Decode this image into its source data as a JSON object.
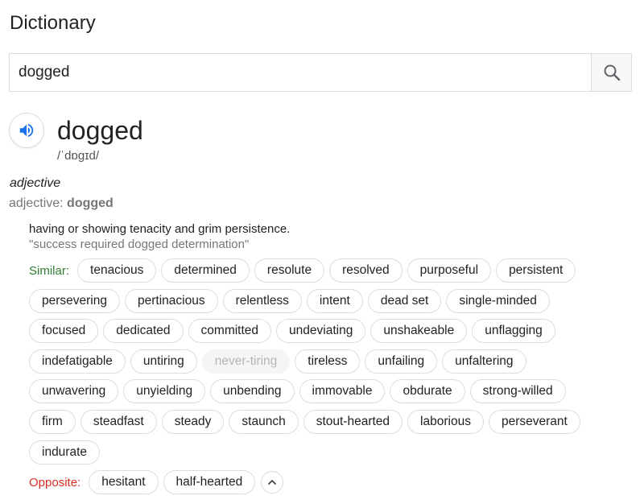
{
  "header": {
    "title": "Dictionary"
  },
  "search": {
    "value": "dogged",
    "placeholder": ""
  },
  "entry": {
    "word": "dogged",
    "phonetic": "/ˈdɒɡɪd/",
    "part_of_speech": "adjective",
    "pos_prefix": "adjective: ",
    "pos_word": "dogged",
    "definition": "having or showing tenacity and grim persistence.",
    "example": "\"success required dogged determination\""
  },
  "similar": {
    "label": "Similar:",
    "rows": [
      [
        "tenacious",
        "determined",
        "resolute",
        "resolved",
        "purposeful",
        "persistent"
      ],
      [
        "persevering",
        "pertinacious",
        "relentless",
        "intent",
        "dead set",
        "single-minded"
      ],
      [
        "focused",
        "dedicated",
        "committed",
        "undeviating",
        "unshakeable",
        "unflagging"
      ],
      [
        "indefatigable",
        "untiring",
        "never-tiring",
        "tireless",
        "unfailing",
        "unfaltering"
      ],
      [
        "unwavering",
        "unyielding",
        "unbending",
        "immovable",
        "obdurate",
        "strong-willed"
      ],
      [
        "firm",
        "steadfast",
        "steady",
        "staunch",
        "stout-hearted",
        "laborious",
        "perseverant"
      ],
      [
        "indurate"
      ]
    ],
    "muted": [
      "never-tiring"
    ]
  },
  "opposite": {
    "label": "Opposite:",
    "words": [
      "hesitant",
      "half-hearted"
    ]
  },
  "icons": {
    "search": "search-icon",
    "audio": "speaker-icon",
    "expand": "chevron-up-icon"
  },
  "colors": {
    "accent_blue": "#1a73e8",
    "similar_green": "#2e7d32",
    "opposite_red": "#d93025"
  }
}
